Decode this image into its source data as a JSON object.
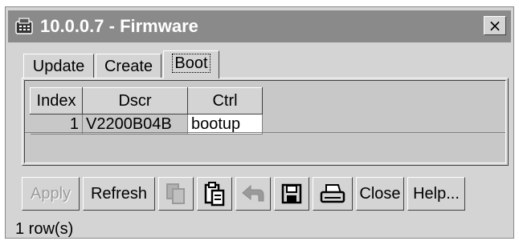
{
  "window": {
    "title": "10.0.0.7 - Firmware",
    "close_label": "×",
    "icon": "firmware-device-icon"
  },
  "tabs": [
    {
      "label": "Update",
      "active": false
    },
    {
      "label": "Create",
      "active": false
    },
    {
      "label": "Boot",
      "active": true
    }
  ],
  "table": {
    "columns": [
      "Index",
      "Dscr",
      "Ctrl"
    ],
    "rows": [
      {
        "index": "1",
        "dscr": "V2200B04B",
        "ctrl": "bootup"
      }
    ]
  },
  "toolbar": {
    "apply_label": "Apply",
    "refresh_label": "Refresh",
    "copy_icon": "copy-icon",
    "paste_icon": "paste-icon",
    "undo_icon": "undo-icon",
    "save_icon": "save-icon",
    "print_icon": "print-icon",
    "close_label": "Close",
    "help_label": "Help..."
  },
  "status": {
    "text": "1 row(s)"
  }
}
